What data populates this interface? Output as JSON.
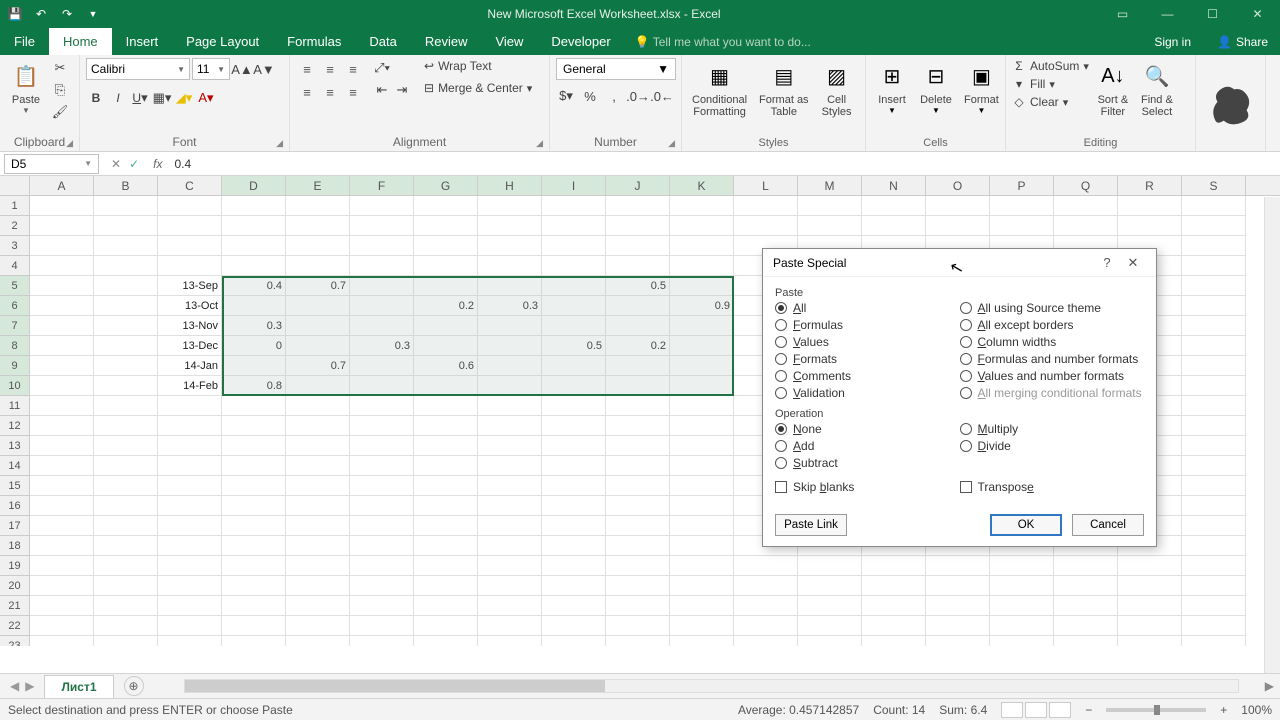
{
  "title": "New Microsoft Excel Worksheet.xlsx - Excel",
  "menutabs": [
    "File",
    "Home",
    "Insert",
    "Page Layout",
    "Formulas",
    "Data",
    "Review",
    "View",
    "Developer"
  ],
  "tellme": "Tell me what you want to do...",
  "signin": "Sign in",
  "share": "Share",
  "ribbon": {
    "clipboard": {
      "paste": "Paste",
      "label": "Clipboard"
    },
    "font": {
      "name": "Calibri",
      "size": "11",
      "label": "Font"
    },
    "alignment": {
      "wrap": "Wrap Text",
      "merge": "Merge & Center",
      "label": "Alignment"
    },
    "number": {
      "format": "General",
      "label": "Number"
    },
    "styles": {
      "cond": "Conditional\nFormatting",
      "fmtas": "Format as\nTable",
      "cell": "Cell\nStyles",
      "label": "Styles"
    },
    "cells": {
      "insert": "Insert",
      "delete": "Delete",
      "format": "Format",
      "label": "Cells"
    },
    "editing": {
      "autosum": "AutoSum",
      "fill": "Fill",
      "clear": "Clear",
      "sort": "Sort &\nFilter",
      "find": "Find &\nSelect",
      "label": "Editing"
    }
  },
  "namebox": "D5",
  "formula": "0.4",
  "columns": [
    "A",
    "B",
    "C",
    "D",
    "E",
    "F",
    "G",
    "H",
    "I",
    "J",
    "K",
    "L",
    "M",
    "N",
    "O",
    "P",
    "Q",
    "R",
    "S"
  ],
  "rows_count": 23,
  "cells": {
    "5": {
      "C": "13-Sep",
      "D": "0.4",
      "E": "0.7",
      "J": "0.5"
    },
    "6": {
      "C": "13-Oct",
      "G": "0.2",
      "H": "0.3",
      "K": "0.9"
    },
    "7": {
      "C": "13-Nov",
      "D": "0.3"
    },
    "8": {
      "C": "13-Dec",
      "D": "0",
      "F": "0.3",
      "I": "0.5",
      "J": "0.2"
    },
    "9": {
      "C": "14-Jan",
      "E": "0.7",
      "G": "0.6"
    },
    "10": {
      "C": "14-Feb",
      "D": "0.8"
    }
  },
  "sel_rows": [
    5,
    6,
    7,
    8,
    9,
    10
  ],
  "sel_cols": [
    "D",
    "E",
    "F",
    "G",
    "H",
    "I",
    "J",
    "K"
  ],
  "sheet": "Лист1",
  "status": {
    "msg": "Select destination and press ENTER or choose Paste",
    "avg": "Average: 0.457142857",
    "count": "Count: 14",
    "sum": "Sum: 6.4",
    "zoom": "100%"
  },
  "dialog": {
    "title": "Paste Special",
    "paste_label": "Paste",
    "paste_left": [
      "All",
      "Formulas",
      "Values",
      "Formats",
      "Comments",
      "Validation"
    ],
    "paste_right": [
      "All using Source theme",
      "All except borders",
      "Column widths",
      "Formulas and number formats",
      "Values and number formats",
      "All merging conditional formats"
    ],
    "op_label": "Operation",
    "op_left": [
      "None",
      "Add",
      "Subtract"
    ],
    "op_right": [
      "Multiply",
      "Divide"
    ],
    "skip": "Skip blanks",
    "transpose": "Transpose",
    "pastelink": "Paste Link",
    "ok": "OK",
    "cancel": "Cancel"
  }
}
